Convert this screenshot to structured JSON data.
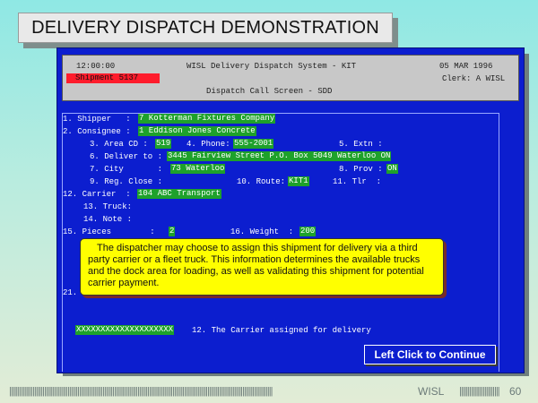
{
  "slide": {
    "title": "DELIVERY DISPATCH DEMONSTRATION"
  },
  "header": {
    "time": "12:00:00",
    "system": "WISL Delivery Dispatch System - KIT",
    "date": "05 MAR 1996",
    "shipment": "Shipment 5137",
    "clerk": "Clerk: A WISL",
    "screen_name": "Dispatch Call Screen - SDD"
  },
  "form": {
    "shipper_label": "1. Shipper   :",
    "shipper_value": "7 Kotterman Fixtures Company",
    "consignee_label": "2. Consignee :",
    "consignee_value": "1 Eddison Jones Concrete",
    "area_label": "3. Area CD :",
    "area_value": "519",
    "phone_label": "4. Phone:",
    "phone_value": "555-2001",
    "extn_label": "5. Extn :",
    "deliver_label": "6. Deliver to :",
    "deliver_value": "3445 Fairview Street P.O. Box 5049 Waterloo ON",
    "city_label": "7. City       :",
    "city_value": "73 Waterloo",
    "prov_label": "8. Prov :",
    "prov_value": "ON",
    "regclose_label": "9. Reg. Close :",
    "route_label": "10. Route:",
    "route_value": "KIT1",
    "tlr_label": "11. Tlr  :",
    "carrier_label": "12. Carrier  :",
    "carrier_value": "104 ABC Transport",
    "truck_label": "13. Truck:",
    "note_label": "14. Note :",
    "pieces_label": "15. Pieces        :",
    "pieces_value": "2",
    "weight_label": "16. Weight  :",
    "weight_value": "200",
    "row21_label": "21.",
    "status_value": "XXXXXXXXXXXXXXXXXXXX",
    "status_text": "12. The Carrier assigned for delivery"
  },
  "callout": {
    "text": "The dispatcher may choose to assign this shipment for delivery via a third party carrier or a fleet truck. This information determines the available trucks and the dock area for loading, as well as validating this shipment for potential carrier payment."
  },
  "continue_button": {
    "label": "Left Click to Continue"
  },
  "footer": {
    "brand": "WISL",
    "page": "60"
  },
  "colors": {
    "screen": "#0c1ecf",
    "field": "#1ea12b",
    "shipment_badge": "#ff1c2c",
    "callout": "#ffff00"
  }
}
